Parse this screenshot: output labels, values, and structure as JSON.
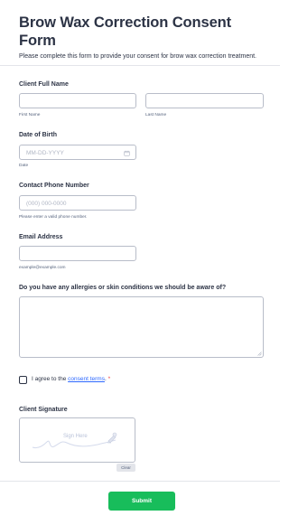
{
  "form": {
    "title": "Brow Wax Correction Consent Form",
    "subtitle": "Please complete this form to provide your consent for brow wax correction treatment."
  },
  "client_name": {
    "label": "Client Full Name",
    "first_sublabel": "First Name",
    "last_sublabel": "Last Name",
    "first_value": "",
    "last_value": ""
  },
  "dob": {
    "label": "Date of Birth",
    "placeholder": "MM-DD-YYYY",
    "sublabel": "Date",
    "icon": "calendar-icon"
  },
  "phone": {
    "label": "Contact Phone Number",
    "placeholder": "(000) 000-0000",
    "sublabel": "Please enter a valid phone number."
  },
  "email": {
    "label": "Email Address",
    "sublabel": "example@example.com",
    "value": ""
  },
  "allergies": {
    "label": "Do you have any allergies or skin conditions we should be aware of?",
    "value": ""
  },
  "consent": {
    "text_before": "I agree to the ",
    "link_text": "consent terms",
    "text_after": ".",
    "required_mark": "*",
    "checked": false
  },
  "signature": {
    "label": "Client Signature",
    "placeholder": "Sign Here",
    "clear_label": "Clear",
    "icon": "pen-icon"
  },
  "submit": {
    "label": "Submit",
    "color": "#18bd5b"
  },
  "colors": {
    "text": "#2c3345",
    "link": "#2e69ff",
    "required": "#f23a3c",
    "border": "#b8bdc9"
  }
}
